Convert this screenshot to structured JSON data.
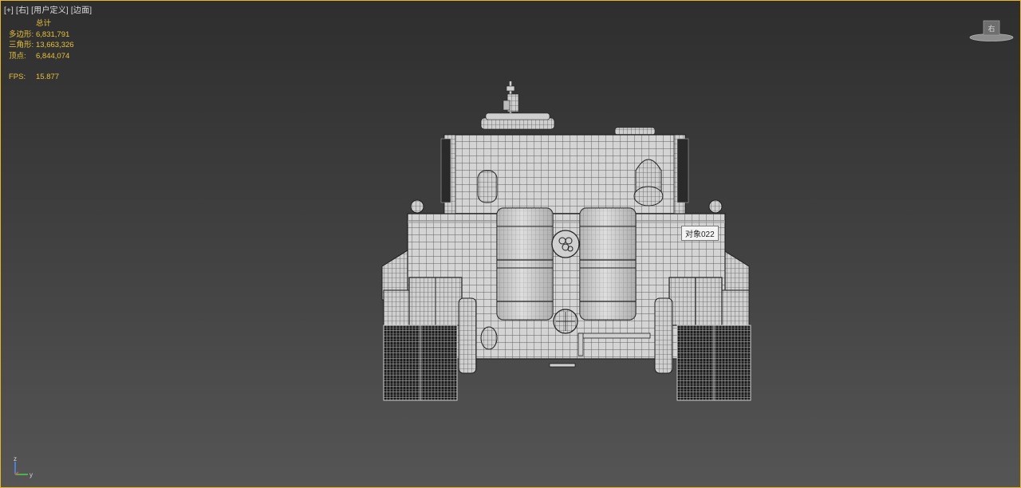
{
  "viewport": {
    "label_parts": [
      "[+]",
      "[右]",
      "[用户定义]",
      "[边面]"
    ]
  },
  "stats": {
    "header": "总计",
    "polys_label": "多边形:",
    "polys_value": "6,831,791",
    "tris_label": "三角形:",
    "tris_value": "13,663,326",
    "verts_label": "顶点:",
    "verts_value": "6,844,074",
    "fps_label": "FPS:",
    "fps_value": "15.877"
  },
  "viewcube": {
    "face_label": "右"
  },
  "tooltip": {
    "text": "对象022"
  },
  "axis": {
    "z_label": "z",
    "y_label": "y"
  },
  "colors": {
    "active_border": "#e8b828",
    "stats_text": "#e8c23a",
    "axis_z": "#4a8cff",
    "axis_y": "#4cd04c",
    "axis_x": "#e84c4c"
  }
}
